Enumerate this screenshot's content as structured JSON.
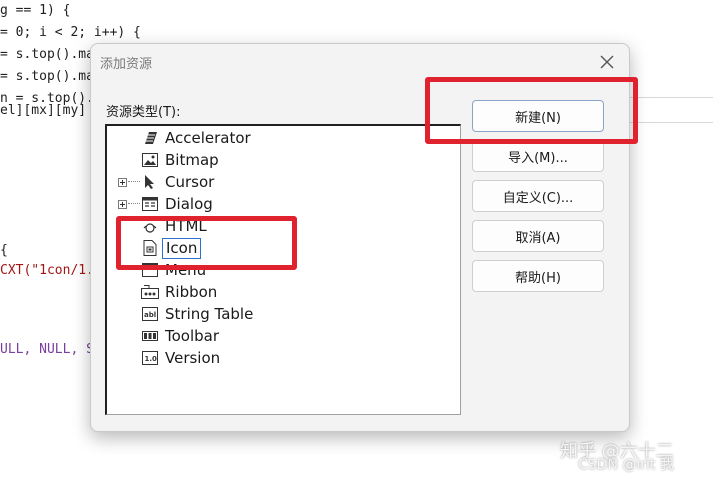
{
  "code_lines": [
    "g == 1) {",
    "= 0; i < 2; i++) {",
    "= s.top().ma",
    "= s.top().ma",
    "n = s.top().",
    "el][mx][my]",
    "{",
    "CXT(\"1con/1.",
    "ULL, NULL, S"
  ],
  "dialog": {
    "title": "添加资源",
    "close_icon": "close-icon",
    "type_label": "资源类型(T):",
    "tree_items": [
      {
        "label": "Accelerator",
        "icon": "accelerator-icon",
        "expandable": false
      },
      {
        "label": "Bitmap",
        "icon": "bitmap-icon",
        "expandable": false
      },
      {
        "label": "Cursor",
        "icon": "cursor-icon",
        "expandable": true
      },
      {
        "label": "Dialog",
        "icon": "dialog-icon",
        "expandable": true
      },
      {
        "label": "HTML",
        "icon": "html-icon",
        "expandable": false
      },
      {
        "label": "Icon",
        "icon": "icon-resource-icon",
        "expandable": false,
        "selected": true
      },
      {
        "label": "Menu",
        "icon": "menu-icon",
        "expandable": false
      },
      {
        "label": "Ribbon",
        "icon": "ribbon-icon",
        "expandable": false
      },
      {
        "label": "String Table",
        "icon": "string-table-icon",
        "expandable": false
      },
      {
        "label": "Toolbar",
        "icon": "toolbar-icon",
        "expandable": false
      },
      {
        "label": "Version",
        "icon": "version-icon",
        "expandable": false
      }
    ],
    "buttons": {
      "new": "新建(N)",
      "import": "导入(M)...",
      "custom": "自定义(C)...",
      "cancel": "取消(A)",
      "help": "帮助(H)"
    }
  },
  "watermarks": {
    "zhihu": "知乎 @六十二",
    "csdn": "CSDN @irit 我"
  },
  "colors": {
    "highlight": "#e0212e",
    "selection_border": "#2f6fd0",
    "dialog_bg": "#f3f3f3"
  }
}
